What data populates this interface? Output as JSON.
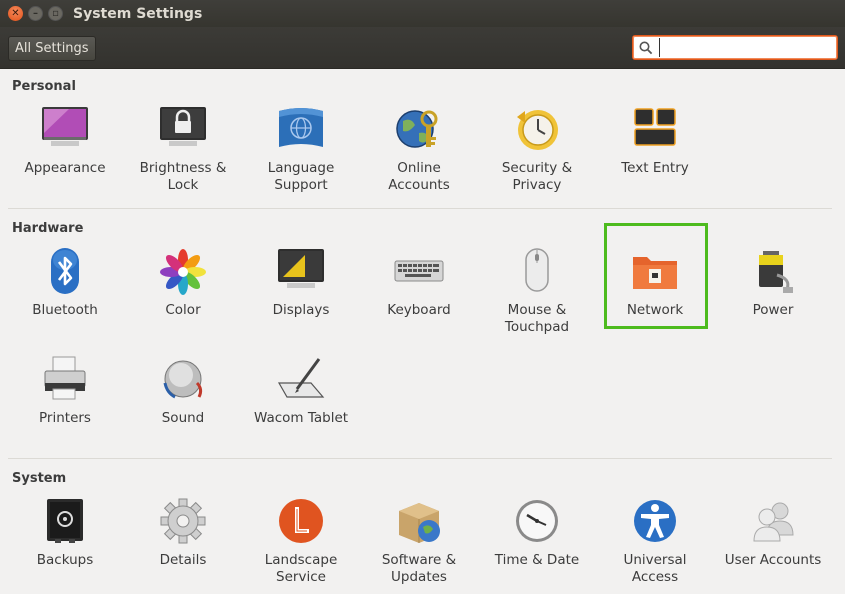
{
  "window": {
    "title": "System Settings"
  },
  "toolbar": {
    "all_settings_label": "All Settings",
    "search_value": "",
    "search_placeholder": ""
  },
  "sections": {
    "personal": {
      "title": "Personal",
      "items": [
        {
          "label": "Appearance",
          "icon": "appearance-icon"
        },
        {
          "label": "Brightness &\nLock",
          "icon": "brightness-lock-icon"
        },
        {
          "label": "Language\nSupport",
          "icon": "language-support-icon"
        },
        {
          "label": "Online\nAccounts",
          "icon": "online-accounts-icon"
        },
        {
          "label": "Security &\nPrivacy",
          "icon": "security-privacy-icon"
        },
        {
          "label": "Text Entry",
          "icon": "text-entry-icon"
        }
      ]
    },
    "hardware": {
      "title": "Hardware",
      "items": [
        {
          "label": "Bluetooth",
          "icon": "bluetooth-icon"
        },
        {
          "label": "Color",
          "icon": "color-icon"
        },
        {
          "label": "Displays",
          "icon": "displays-icon"
        },
        {
          "label": "Keyboard",
          "icon": "keyboard-icon"
        },
        {
          "label": "Mouse &\nTouchpad",
          "icon": "mouse-icon"
        },
        {
          "label": "Network",
          "icon": "network-icon"
        },
        {
          "label": "Power",
          "icon": "power-icon"
        },
        {
          "label": "Printers",
          "icon": "printer-icon"
        },
        {
          "label": "Sound",
          "icon": "sound-icon"
        },
        {
          "label": "Wacom Tablet",
          "icon": "wacom-tablet-icon"
        }
      ]
    },
    "system": {
      "title": "System",
      "items": [
        {
          "label": "Backups",
          "icon": "backups-icon"
        },
        {
          "label": "Details",
          "icon": "details-gear-icon"
        },
        {
          "label": "Landscape\nService",
          "icon": "landscape-icon"
        },
        {
          "label": "Software &\nUpdates",
          "icon": "software-updates-icon"
        },
        {
          "label": "Time & Date",
          "icon": "clock-icon"
        },
        {
          "label": "Universal\nAccess",
          "icon": "universal-access-icon"
        },
        {
          "label": "User Accounts",
          "icon": "user-accounts-icon"
        }
      ]
    }
  },
  "colors": {
    "highlight": "#4dbb1e",
    "close_button": "#e25118",
    "titlebar": "#3c3b37"
  }
}
